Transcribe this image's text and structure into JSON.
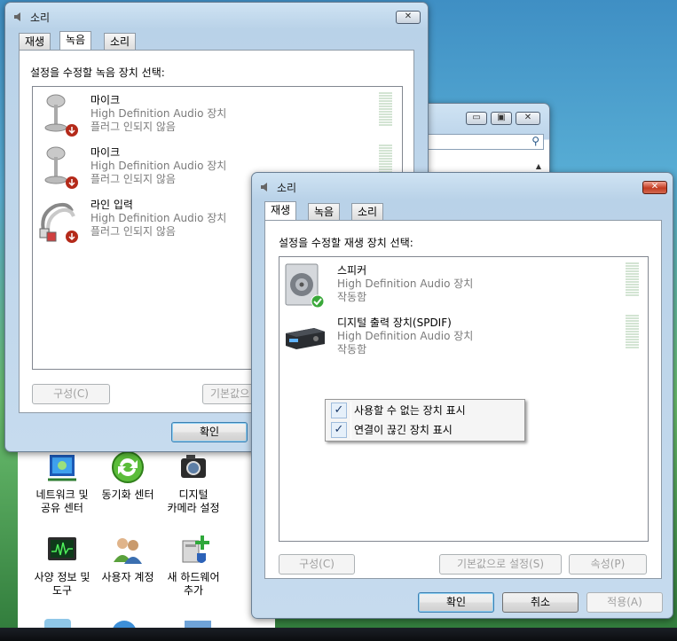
{
  "back_window": {
    "title": "소리",
    "tabs": [
      "재생",
      "녹음",
      "소리"
    ],
    "selected_tab": "녹음",
    "instruction": "설정을 수정할 녹음 장치 선택:",
    "devices": [
      {
        "name": "마이크",
        "driver": "High Definition Audio 장치",
        "status": "플러그 인되지 않음",
        "icon": "microphone-icon"
      },
      {
        "name": "마이크",
        "driver": "High Definition Audio 장치",
        "status": "플러그 인되지 않음",
        "icon": "microphone-icon"
      },
      {
        "name": "라인 입력",
        "driver": "High Definition Audio 장치",
        "status": "플러그 인되지 않음",
        "icon": "line-in-cable-icon"
      }
    ],
    "configure_label": "구성(C)",
    "default_label": "기본값으",
    "ok_label": "확인"
  },
  "explorer_window": {
    "search_icon": "search-icon"
  },
  "control_panel": {
    "items": [
      {
        "label1": "네트워크 및",
        "label2": "공유 센터",
        "icon": "network-icon"
      },
      {
        "label1": "동기화 센터",
        "label2": "",
        "icon": "sync-icon"
      },
      {
        "label1": "디지털",
        "label2": "카메라 설정",
        "icon": "camera-icon"
      },
      {
        "label1": "사양 정보 및",
        "label2": "도구",
        "icon": "performance-icon"
      },
      {
        "label1": "사용자 계정",
        "label2": "",
        "icon": "users-icon"
      },
      {
        "label1": "새 하드웨어",
        "label2": "추가",
        "icon": "add-hardware-icon"
      }
    ]
  },
  "front_window": {
    "title": "소리",
    "tabs": [
      "재생",
      "녹음",
      "소리"
    ],
    "selected_tab": "재생",
    "instruction": "설정을 수정할 재생 장치 선택:",
    "devices": [
      {
        "name": "스피커",
        "driver": "High Definition Audio 장치",
        "status": "작동함",
        "icon": "speaker-icon"
      },
      {
        "name": "디지털 출력 장치(SPDIF)",
        "driver": "High Definition Audio 장치",
        "status": "작동함",
        "icon": "spdif-receiver-icon"
      }
    ],
    "context_menu": [
      {
        "label": "사용할 수 없는 장치 표시",
        "checked": true
      },
      {
        "label": "연결이 끊긴 장치 표시",
        "checked": true
      }
    ],
    "check_glyph": "✓",
    "configure_label": "구성(C)",
    "default_label": "기본값으로 설정(S)",
    "properties_label": "속성(P)",
    "ok_label": "확인",
    "cancel_label": "취소",
    "apply_label": "적용(A)"
  },
  "colors": {
    "accent": "#3c7fb1",
    "close_red": "#c33b22"
  }
}
